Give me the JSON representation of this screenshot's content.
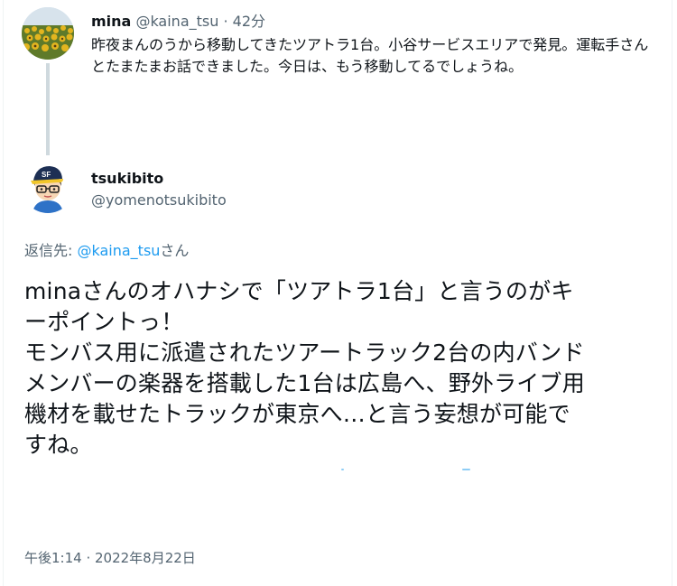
{
  "parent_tweet": {
    "name": "mina",
    "handle": "@kaina_tsu",
    "separator": " · ",
    "time": "42分",
    "text": "昨夜まんのうから移動してきたツアトラ1台。小谷サービスエリアで発見。運転手さんとたまたまお話できました。今日は、もう移動してるでしょうね。"
  },
  "reply_tweet": {
    "name": "tsukibito",
    "handle": "@yomenotsukibito",
    "reply_to_label": "返信先: ",
    "reply_to_handle": "@kaina_tsu",
    "reply_to_suffix": "さん",
    "text_lines": [
      "minaさんのオハナシで「ツアトラ1台」と言うのがキ",
      "ーポイントっ！",
      "モンバス用に派遣されたツアートラック2台の内バンド",
      "メンバーの楽器を搭載した1台は広島へ、野外ライブ用",
      "機材を載せたトラックが東京へ…と言う妄想が可能で",
      "すね。"
    ],
    "timestamp": "午後1:14 · 2022年8月22日"
  },
  "colors": {
    "link": "#1d9bf0",
    "secondary_text": "#536471",
    "thread_line": "#cfd9de"
  },
  "icons": {
    "parent_avatar": "sunflower-field-avatar",
    "reply_avatar": "cartoon-boy-cap-glasses-avatar"
  }
}
